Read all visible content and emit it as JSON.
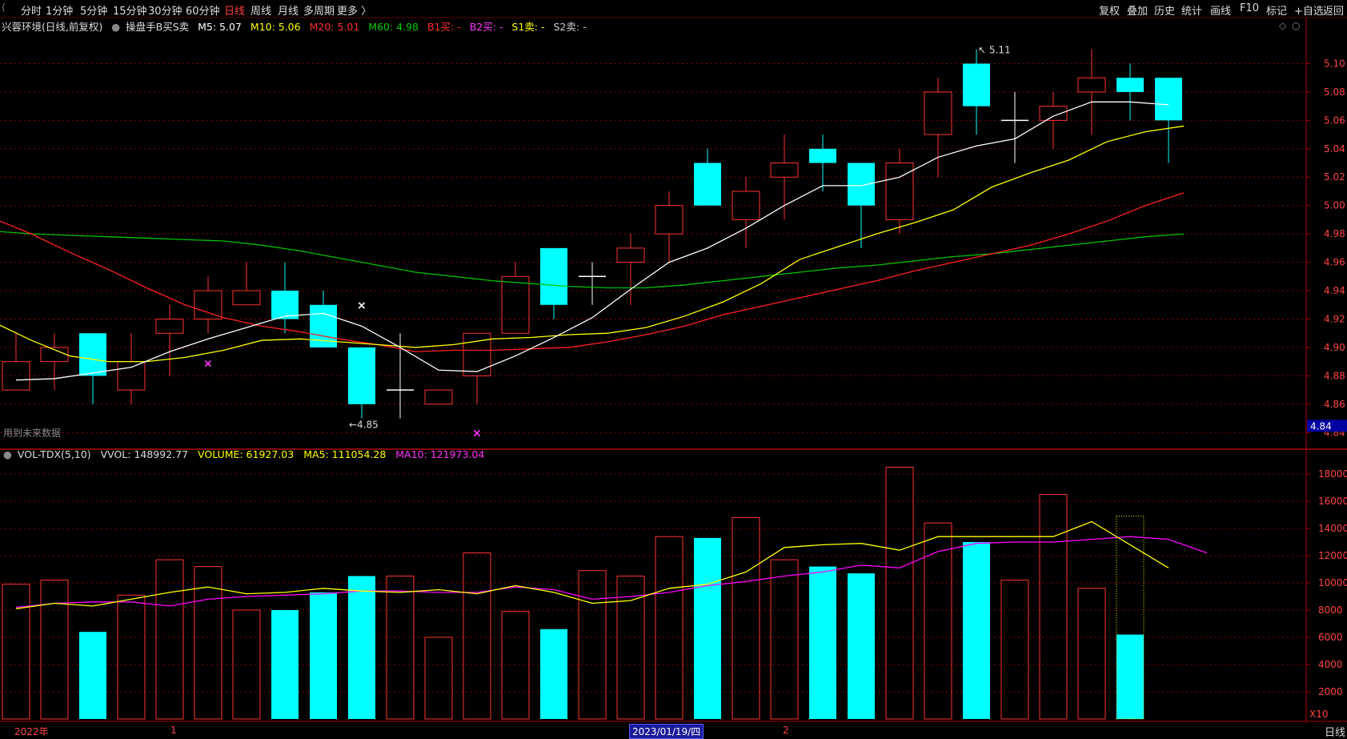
{
  "toolbar": {
    "left": [
      "分时",
      "1分钟",
      "5分钟",
      "15分钟",
      "30分钟",
      "60分钟",
      "日线",
      "周线",
      "月线",
      "多周期",
      "更多 〉"
    ],
    "active": "日线",
    "right": [
      "复权",
      "叠加",
      "历史",
      "统计",
      "画线",
      "F10",
      "标记",
      "+自选",
      "返回"
    ]
  },
  "legend": {
    "title": "兴蓉环境(日线,前复权)",
    "indicator": "操盘手B买S卖",
    "m5": "M5: 5.07",
    "m10": "M10: 5.06",
    "m20": "M20: 5.01",
    "m60": "M60: 4.98",
    "b1": "B1买: -",
    "b2": "B2买: -",
    "s1": "S1卖: -",
    "s2": "S2卖: -"
  },
  "note": "用到未来数据",
  "volume_legend": {
    "name": "VOL-TDX(5,10)",
    "vvol": "VVOL: 148992.77",
    "volume": "VOLUME: 61927.03",
    "ma5": "MA5: 111054.28",
    "ma10": "MA10: 121973.04"
  },
  "annotations": {
    "high": "5.11",
    "low": "4.85"
  },
  "current_price": "4.84",
  "x10_label": "X10",
  "date_bar": {
    "year": "2022年",
    "m1": "1",
    "current": "2023/01/19/四",
    "m2": "2"
  },
  "period_label": "日线",
  "colors": {
    "up": "#ff3232",
    "down": "#00ffff",
    "m5": "#ffffff",
    "m10": "#ffff00",
    "m20": "#ff2020",
    "m60": "#00c000",
    "vma5": "#ffff00",
    "vma10": "#ff00ff",
    "grid": "#8b0000"
  },
  "chart_data": {
    "type": "candlestick",
    "price_axis": {
      "ylim": [
        4.83,
        5.12
      ],
      "ticks": [
        "5.10",
        "5.08",
        "5.06",
        "5.04",
        "5.02",
        "5.00",
        "4.98",
        "4.96",
        "4.94",
        "4.92",
        "4.90",
        "4.88",
        "4.86",
        "4.84"
      ]
    },
    "volume_axis": {
      "ylim": [
        0,
        19000
      ],
      "ticks": [
        "18000",
        "16000",
        "14000",
        "12000",
        "10000",
        "8000",
        "6000",
        "4000",
        "2000"
      ]
    },
    "candles": [
      {
        "o": 4.87,
        "h": 4.91,
        "l": 4.87,
        "c": 4.89
      },
      {
        "o": 4.89,
        "h": 4.91,
        "l": 4.87,
        "c": 4.9
      },
      {
        "o": 4.91,
        "h": 4.91,
        "l": 4.86,
        "c": 4.88
      },
      {
        "o": 4.87,
        "h": 4.91,
        "l": 4.86,
        "c": 4.89
      },
      {
        "o": 4.91,
        "h": 4.93,
        "l": 4.88,
        "c": 4.92
      },
      {
        "o": 4.92,
        "h": 4.95,
        "l": 4.91,
        "c": 4.94
      },
      {
        "o": 4.93,
        "h": 4.96,
        "l": 4.93,
        "c": 4.94
      },
      {
        "o": 4.94,
        "h": 4.96,
        "l": 4.91,
        "c": 4.92
      },
      {
        "o": 4.93,
        "h": 4.94,
        "l": 4.9,
        "c": 4.9
      },
      {
        "o": 4.9,
        "h": 4.9,
        "l": 4.85,
        "c": 4.86
      },
      {
        "o": 4.87,
        "h": 4.91,
        "l": 4.85,
        "c": 4.87
      },
      {
        "o": 4.86,
        "h": 4.87,
        "l": 4.86,
        "c": 4.87
      },
      {
        "o": 4.88,
        "h": 4.91,
        "l": 4.86,
        "c": 4.91
      },
      {
        "o": 4.91,
        "h": 4.96,
        "l": 4.91,
        "c": 4.95
      },
      {
        "o": 4.97,
        "h": 4.97,
        "l": 4.92,
        "c": 4.93
      },
      {
        "o": 4.95,
        "h": 4.96,
        "l": 4.93,
        "c": 4.95
      },
      {
        "o": 4.96,
        "h": 4.98,
        "l": 4.93,
        "c": 4.97
      },
      {
        "o": 4.98,
        "h": 5.01,
        "l": 4.96,
        "c": 5.0
      },
      {
        "o": 5.03,
        "h": 5.04,
        "l": 5.0,
        "c": 5.0
      },
      {
        "o": 4.99,
        "h": 5.02,
        "l": 4.97,
        "c": 5.01
      },
      {
        "o": 5.02,
        "h": 5.05,
        "l": 4.99,
        "c": 5.03
      },
      {
        "o": 5.04,
        "h": 5.05,
        "l": 5.01,
        "c": 5.03
      },
      {
        "o": 5.03,
        "h": 5.03,
        "l": 4.97,
        "c": 5.0
      },
      {
        "o": 4.99,
        "h": 5.04,
        "l": 4.98,
        "c": 5.03
      },
      {
        "o": 5.05,
        "h": 5.09,
        "l": 5.02,
        "c": 5.08
      },
      {
        "o": 5.1,
        "h": 5.11,
        "l": 5.05,
        "c": 5.07
      },
      {
        "o": 5.06,
        "h": 5.08,
        "l": 5.03,
        "c": 5.06
      },
      {
        "o": 5.06,
        "h": 5.08,
        "l": 5.04,
        "c": 5.07
      },
      {
        "o": 5.08,
        "h": 5.11,
        "l": 5.05,
        "c": 5.09
      },
      {
        "o": 5.09,
        "h": 5.1,
        "l": 5.06,
        "c": 5.08
      },
      {
        "o": 5.09,
        "h": 5.09,
        "l": 5.03,
        "c": 5.06
      }
    ],
    "ma": {
      "M5": [
        4.877,
        4.878,
        4.882,
        4.886,
        4.897,
        4.906,
        4.914,
        4.922,
        4.924,
        4.915,
        4.9,
        4.884,
        4.883,
        4.894,
        4.907,
        4.921,
        4.941,
        4.96,
        4.97,
        4.984,
        5.0,
        5.014,
        5.014,
        5.02,
        5.034,
        5.042,
        5.047,
        5.063,
        5.073,
        5.073,
        5.071
      ],
      "M10": [
        4.918,
        4.905,
        4.894,
        4.89,
        4.89,
        4.893,
        4.898,
        4.905,
        4.906,
        4.904,
        4.902,
        4.9,
        4.902,
        4.906,
        4.907,
        4.909,
        4.91,
        4.914,
        4.922,
        4.932,
        4.945,
        4.962,
        4.971,
        4.98,
        4.988,
        4.997,
        5.013,
        5.023,
        5.032,
        5.045,
        5.052,
        5.056
      ],
      "M20": [
        4.991,
        4.98,
        4.967,
        4.955,
        4.942,
        4.93,
        4.921,
        4.915,
        4.911,
        4.906,
        4.902,
        4.897,
        4.898,
        4.898,
        4.899,
        4.9,
        4.904,
        4.909,
        4.915,
        4.923,
        4.929,
        4.935,
        4.941,
        4.947,
        4.954,
        4.96,
        4.966,
        4.972,
        4.98,
        4.989,
        5.0,
        5.009
      ],
      "M60": [
        4.982,
        4.98,
        4.979,
        4.978,
        4.977,
        4.976,
        4.975,
        4.972,
        4.968,
        4.963,
        4.958,
        4.953,
        4.95,
        4.947,
        4.945,
        4.943,
        4.942,
        4.942,
        4.944,
        4.947,
        4.95,
        4.953,
        4.956,
        4.958,
        4.961,
        4.964,
        4.966,
        4.969,
        4.972,
        4.975,
        4.978,
        4.98
      ]
    },
    "signals": [
      {
        "i": 5,
        "price": 4.889,
        "color": "#ff33ff"
      },
      {
        "i": 9,
        "price": 4.93,
        "color": "#ffffff"
      },
      {
        "i": 12,
        "price": 4.84,
        "color": "#ff33ff"
      }
    ],
    "volume": [
      9900,
      10200,
      6400,
      9100,
      11700,
      11200,
      8000,
      8000,
      9300,
      10500,
      10500,
      6000,
      12200,
      7900,
      6600,
      10900,
      10500,
      13400,
      13300,
      14800,
      11700,
      11200,
      10700,
      18500,
      14400,
      13000,
      10200,
      16500,
      9600,
      6200
    ],
    "vma5": [
      8100,
      8500,
      8300,
      8800,
      9300,
      9700,
      9200,
      9300,
      9600,
      9400,
      9300,
      9500,
      9200,
      9800,
      9300,
      8500,
      8700,
      9600,
      9900,
      10800,
      12600,
      12800,
      12900,
      12400,
      13400,
      13400,
      13400,
      13400,
      14500,
      12800,
      11100
    ],
    "vma10": [
      8200,
      8500,
      8600,
      8600,
      8300,
      8800,
      9000,
      9100,
      9200,
      9400,
      9400,
      9300,
      9300,
      9700,
      9500,
      8800,
      9000,
      9300,
      9800,
      10100,
      10500,
      10800,
      11300,
      11100,
      12300,
      12900,
      13000,
      13000,
      13200,
      13400,
      13200,
      12200
    ]
  }
}
